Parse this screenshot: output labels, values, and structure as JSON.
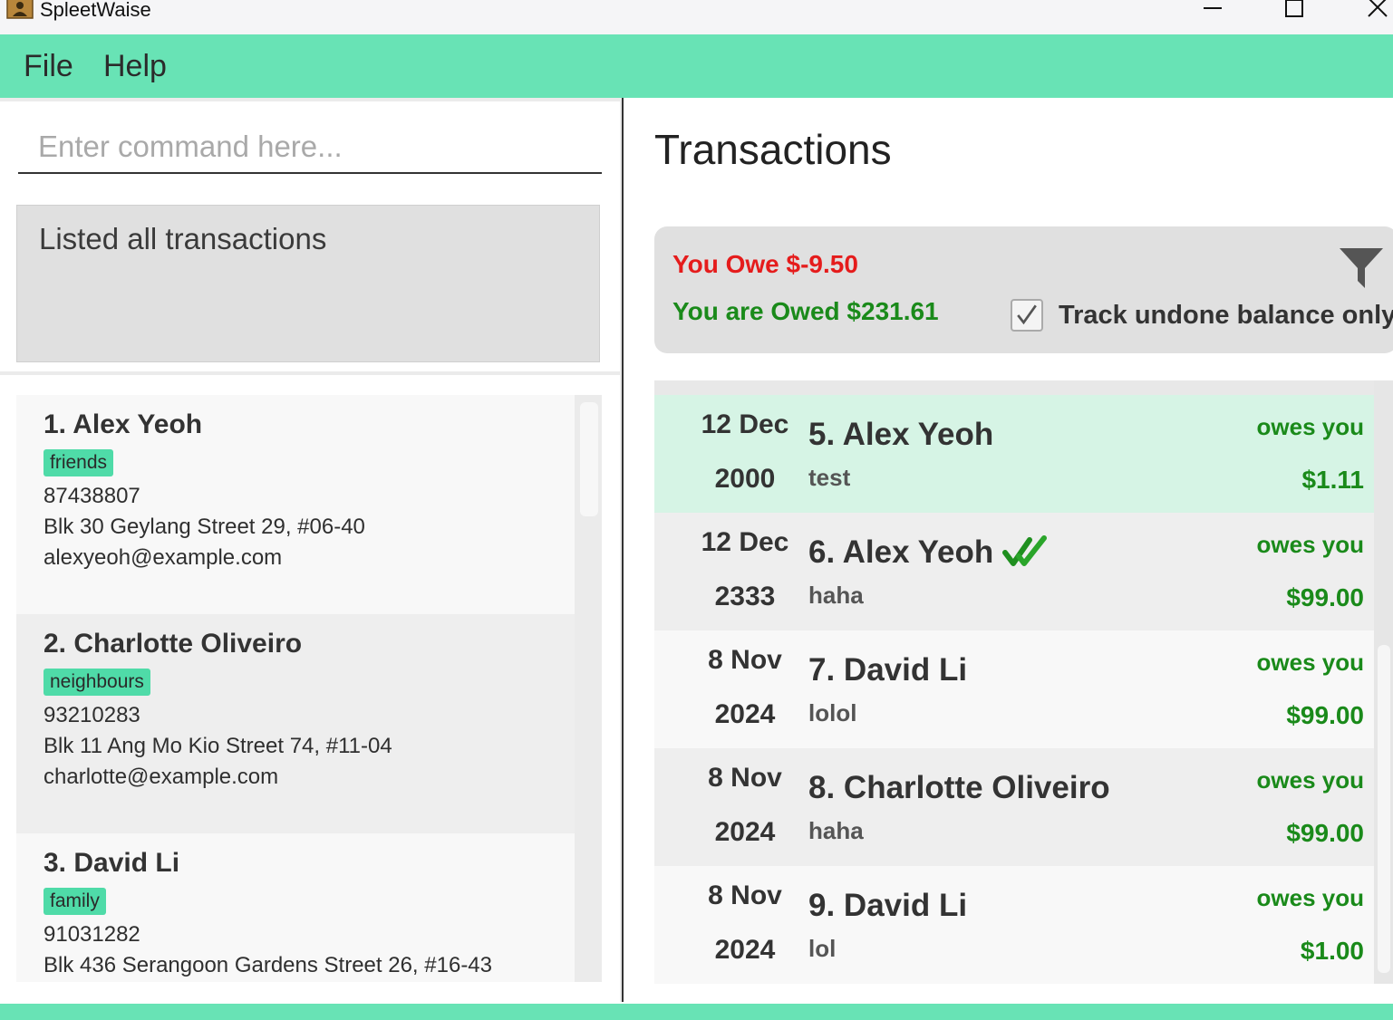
{
  "window": {
    "title": "SpleetWaise",
    "icon": "app-icon",
    "controls": [
      "minimize-icon",
      "maximize-icon",
      "close-icon"
    ]
  },
  "menu": {
    "file": "File",
    "help": "Help"
  },
  "command": {
    "placeholder": "Enter command here...",
    "value": ""
  },
  "result": {
    "message": "Listed all transactions"
  },
  "persons": [
    {
      "name": "1. Alex Yeoh",
      "tag": "friends",
      "phone": "87438807",
      "address": "Blk 30 Geylang Street 29, #06-40",
      "email": "alexyeoh@example.com"
    },
    {
      "name": "2. Charlotte Oliveiro",
      "tag": "neighbours",
      "phone": "93210283",
      "address": "Blk 11 Ang Mo Kio Street 74, #11-04",
      "email": "charlotte@example.com"
    },
    {
      "name": "3. David Li",
      "tag": "family",
      "phone": "91031282",
      "address": "Blk 436 Serangoon Gardens Street 26, #16-43",
      "email": ""
    }
  ],
  "transactions_panel": {
    "title": "Transactions",
    "you_owe": "You Owe $-9.50",
    "you_are_owed": "You are Owed $231.61",
    "track_label": "Track undone balance only",
    "track_checked": true,
    "filter_icon": "filter-icon"
  },
  "transactions": [
    {
      "day": "12 Dec",
      "year": "2000",
      "name": "5. Alex Yeoh",
      "desc": "test",
      "direction": "owes you",
      "amount": "$1.11",
      "done": false,
      "selected": true
    },
    {
      "day": "12 Dec",
      "year": "2333",
      "name": "6. Alex Yeoh",
      "desc": "haha",
      "direction": "owes you",
      "amount": "$99.00",
      "done": true,
      "selected": false
    },
    {
      "day": "8 Nov",
      "year": "2024",
      "name": "7. David Li",
      "desc": "lolol",
      "direction": "owes you",
      "amount": "$99.00",
      "done": false,
      "selected": false
    },
    {
      "day": "8 Nov",
      "year": "2024",
      "name": "8. Charlotte Oliveiro",
      "desc": "haha",
      "direction": "owes you",
      "amount": "$99.00",
      "done": false,
      "selected": false
    },
    {
      "day": "8 Nov",
      "year": "2024",
      "name": "9. David Li",
      "desc": "lol",
      "direction": "owes you",
      "amount": "$1.00",
      "done": false,
      "selected": false
    }
  ],
  "colors": {
    "accent": "#68e3b5",
    "tag": "#4fdba8",
    "owe": "#e51c1c",
    "owed": "#1a8a1a",
    "selected_row": "#d6f4e5"
  }
}
